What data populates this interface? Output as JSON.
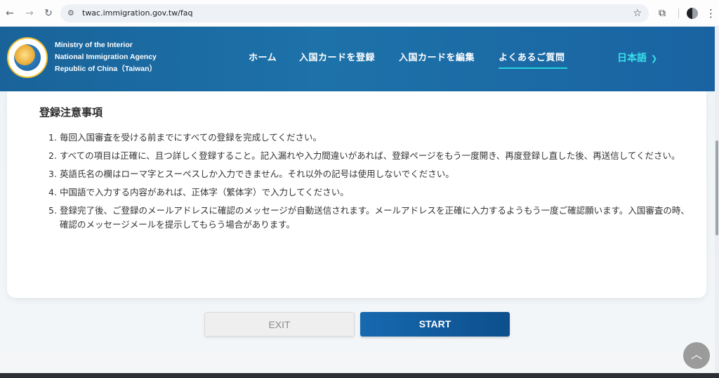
{
  "browser": {
    "url": "twac.immigration.gov.tw/faq",
    "icons": [
      "back-arrow-icon",
      "forward-arrow-icon",
      "reload-icon",
      "site-settings-icon",
      "bookmark-star-icon",
      "extensions-icon",
      "profile-avatar",
      "menu-dots-icon"
    ]
  },
  "header": {
    "agency_lines": [
      "Ministry of the Interior",
      "National Immigration Agency",
      "Republic of China（Taiwan）"
    ],
    "nav": [
      {
        "label": "ホーム",
        "active": false
      },
      {
        "label": "入国カードを登録",
        "active": false
      },
      {
        "label": "入国カードを編集",
        "active": false
      },
      {
        "label": "よくあるご質問",
        "active": true
      }
    ],
    "language": "日本語",
    "colors": {
      "header_bg": "#1d72a9",
      "accent": "#23d3dd"
    }
  },
  "notice": {
    "title": "登録注意事項",
    "items": [
      {
        "num": "1.",
        "text": "毎回入国審査を受ける前までにすべての登録を完成してください。"
      },
      {
        "num": "2.",
        "text": "すべての項目は正確に、且つ詳しく登録すること。記入漏れや入力間違いがあれば、登録ページをもう一度開き、再度登録し直した後、再送信してください。"
      },
      {
        "num": "3.",
        "text": "英語氏名の欄はローマ字とスーペスしか入力できません。それ以外の記号は使用しないでください。"
      },
      {
        "num": "4.",
        "text": "中国語で入力する内容があれば、正体字（繁体字）で入力してください。"
      },
      {
        "num": "5.",
        "text": "登録完了後、ご登録のメールアドレスに確認のメッセージが自動送信されます。メールアドレスを正確に入力するようもう一度ご確認願います。入国審査の時、確認のメッセージメールを提示してもらう場合があります。"
      }
    ]
  },
  "buttons": {
    "exit": "EXIT",
    "start": "START",
    "colors": {
      "start_bg": "#1669b0",
      "exit_bg": "#efefef"
    }
  },
  "back_to_top_icon": "chevron-up-icon"
}
